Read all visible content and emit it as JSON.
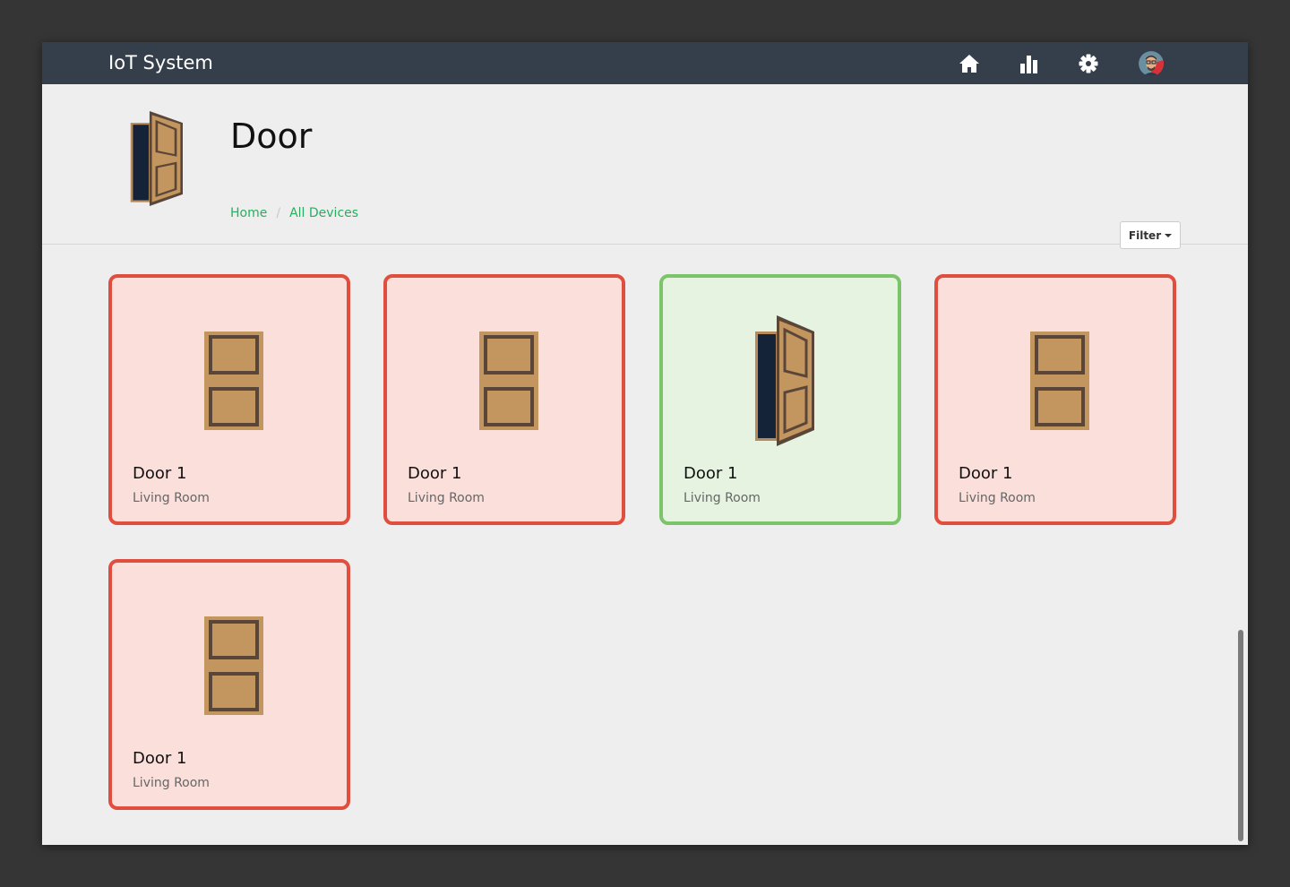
{
  "navbar": {
    "brand": "IoT System",
    "icons": [
      "home-icon",
      "bar-chart-icon",
      "gear-icon",
      "avatar"
    ]
  },
  "header": {
    "title": "Door",
    "breadcrumb": [
      "Home",
      "All Devices"
    ],
    "filter_label": "Filter"
  },
  "devices": [
    {
      "name": "Door 1",
      "room": "Living Room",
      "state": "closed"
    },
    {
      "name": "Door 1",
      "room": "Living Room",
      "state": "closed"
    },
    {
      "name": "Door 1",
      "room": "Living Room",
      "state": "open"
    },
    {
      "name": "Door 1",
      "room": "Living Room",
      "state": "closed"
    },
    {
      "name": "Door 1",
      "room": "Living Room",
      "state": "closed"
    }
  ],
  "colors": {
    "navbar": "#353f4b",
    "accent_green": "#27ae60",
    "closed_border": "#e04e3f",
    "closed_fill": "#fbdfdb",
    "open_border": "#7cc46a",
    "open_fill": "#e6f3e1",
    "door_wood": "#c3955f",
    "door_frame": "#5a4638"
  }
}
